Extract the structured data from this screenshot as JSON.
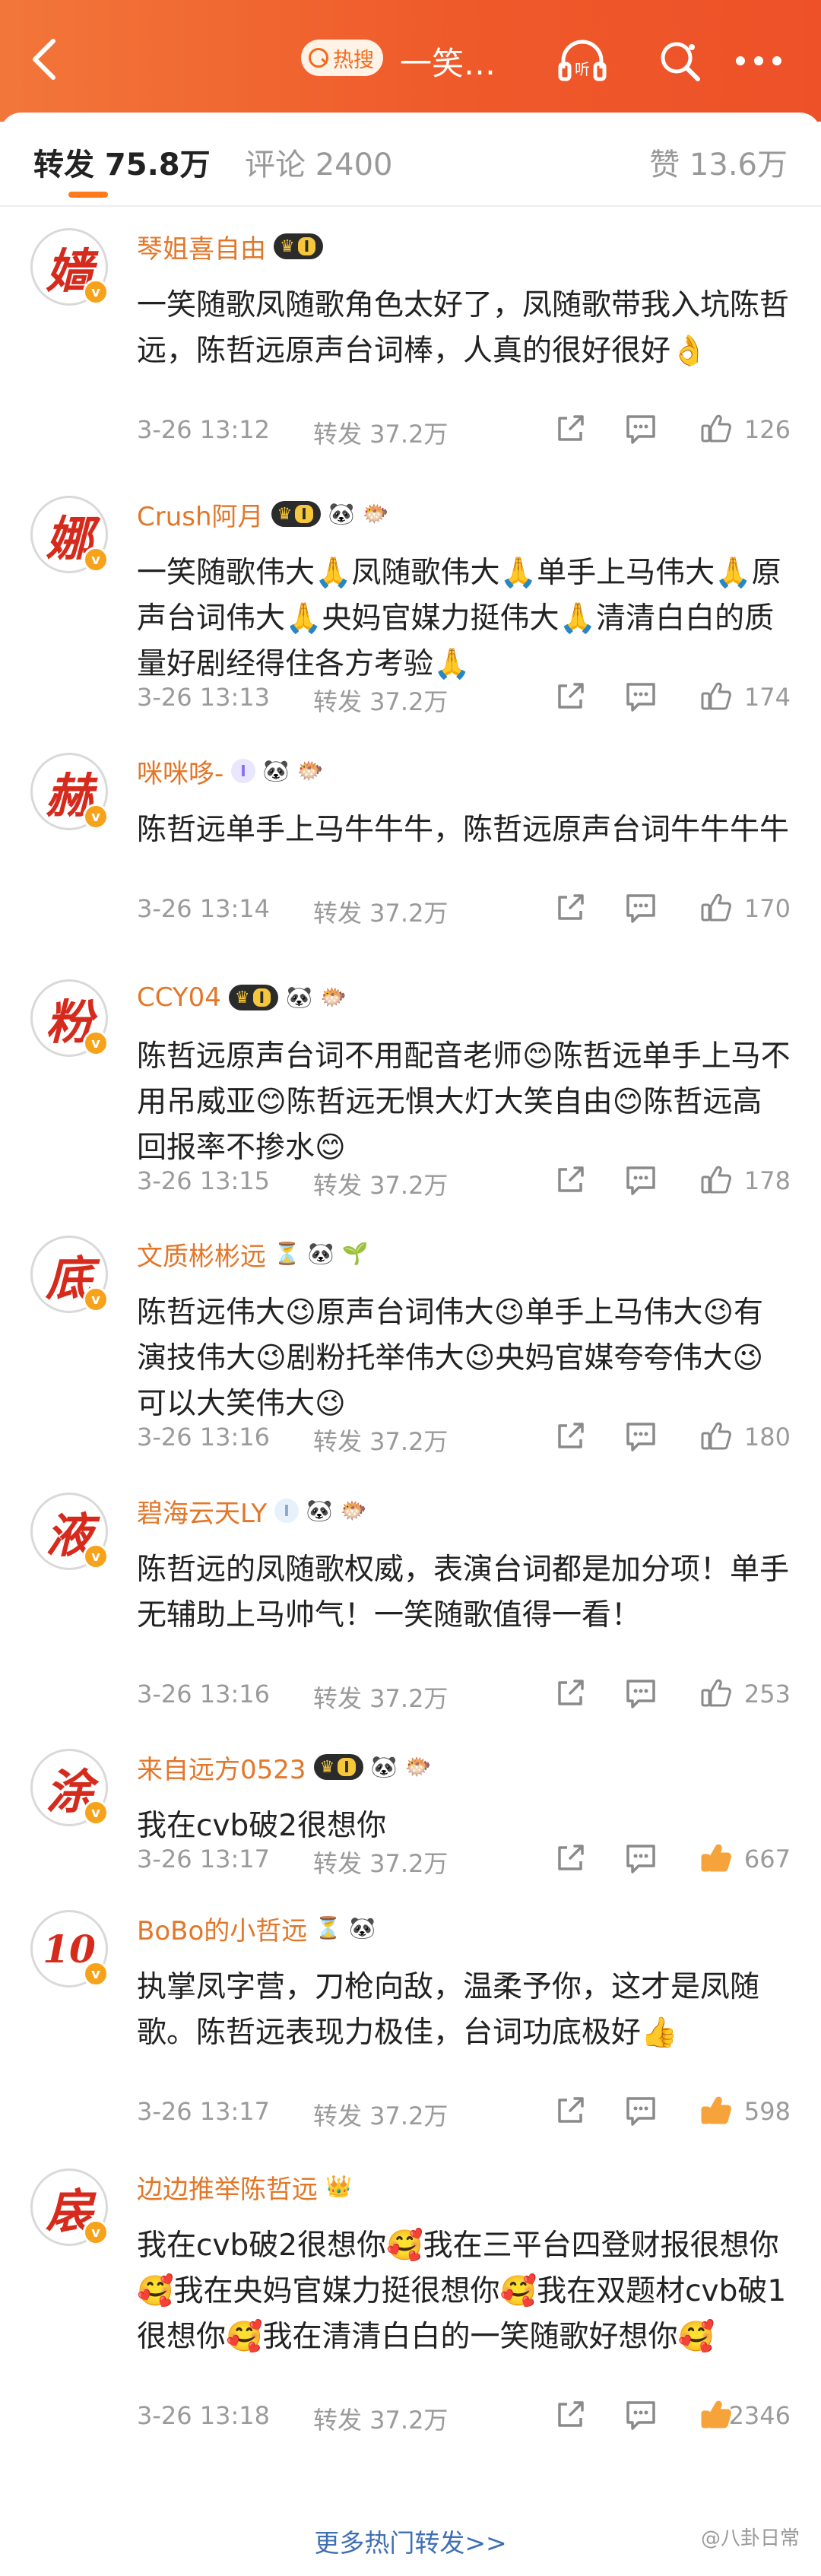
{
  "header": {
    "hot_label": "热搜",
    "title": "一笑…"
  },
  "tabs": {
    "repost": "转发 75.8万",
    "comment": "评论 2400",
    "like": "赞 13.6万"
  },
  "badges": {
    "level_text": "I"
  },
  "comments": [
    {
      "avatar": "嫱",
      "username": "琴姐喜自由",
      "badges": [
        "crown"
      ],
      "text": "一笑随歌凤随歌角色太好了，凤随歌带我入坑陈哲远，陈哲远原声台词棒，人真的很好很好👌",
      "time": "3-26 13:12",
      "repost": "转发 37.2万",
      "likes": "126"
    },
    {
      "avatar": "娜",
      "username": "Crush阿月",
      "badges": [
        "crown",
        "panda",
        "fish"
      ],
      "text": "一笑随歌伟大🙏凤随歌伟大🙏单手上马伟大🙏原声台词伟大🙏央妈官媒力挺伟大🙏清清白白的质量好剧经得住各方考验🙏",
      "time": "3-26 13:13",
      "repost": "转发 37.2万",
      "likes": "174"
    },
    {
      "avatar": "赫",
      "username": "咪咪哆-",
      "badges": [
        "pill",
        "panda",
        "fish"
      ],
      "text": "陈哲远单手上马牛牛牛，陈哲远原声台词牛牛牛牛",
      "time": "3-26 13:14",
      "repost": "转发 37.2万",
      "likes": "170"
    },
    {
      "avatar": "粉",
      "username": "CCY04",
      "badges": [
        "crown",
        "panda",
        "fish"
      ],
      "text": "陈哲远原声台词不用配音老师😊陈哲远单手上马不用吊威亚😊陈哲远无惧大灯大笑自由😊陈哲远高回报率不掺水😊",
      "time": "3-26 13:15",
      "repost": "转发 37.2万",
      "likes": "178"
    },
    {
      "avatar": "底",
      "username": "文质彬彬远",
      "badges": [
        "hourglass",
        "panda",
        "sprout"
      ],
      "text": "陈哲远伟大😉原声台词伟大😉单手上马伟大😉有演技伟大😉剧粉托举伟大😉央妈官媒夸夸伟大😉可以大笑伟大😉",
      "time": "3-26 13:16",
      "repost": "转发 37.2万",
      "likes": "180"
    },
    {
      "avatar": "液",
      "username": "碧海云天LY",
      "badges": [
        "card",
        "panda",
        "fish"
      ],
      "text": "陈哲远的凤随歌权威，表演台词都是加分项！单手无辅助上马帅气！一笑随歌值得一看！",
      "time": "3-26 13:16",
      "repost": "转发 37.2万",
      "likes": "253"
    },
    {
      "avatar": "涂",
      "username": "来自远方0523",
      "badges": [
        "crown",
        "panda",
        "fish"
      ],
      "text": "我在cvb破2很想你",
      "time": "3-26 13:17",
      "repost": "转发 37.2万",
      "likes": "667"
    },
    {
      "avatar": "10",
      "username": "BoBo的小哲远",
      "badges": [
        "hourglass",
        "panda"
      ],
      "text": "执掌凤字营，刀枪向敌，温柔予你，这才是凤随歌。陈哲远表现力极佳，台词功底极好👍",
      "time": "3-26 13:17",
      "repost": "转发 37.2万",
      "likes": "598"
    },
    {
      "avatar": "扆",
      "username": "边边推举陈哲远",
      "badges": [
        "crowd"
      ],
      "text": "我在cvb破2很想你🥰我在三平台四登财报很想你🥰我在央妈官媒力挺很想你🥰我在双题材cvb破1很想你🥰我在清清白白的一笑随歌好想你🥰",
      "time": "3-26 13:18",
      "repost": "转发 37.2万",
      "likes": "2346"
    }
  ],
  "footer": {
    "more": "更多热门转发>>",
    "watermark": "@八卦日常"
  }
}
